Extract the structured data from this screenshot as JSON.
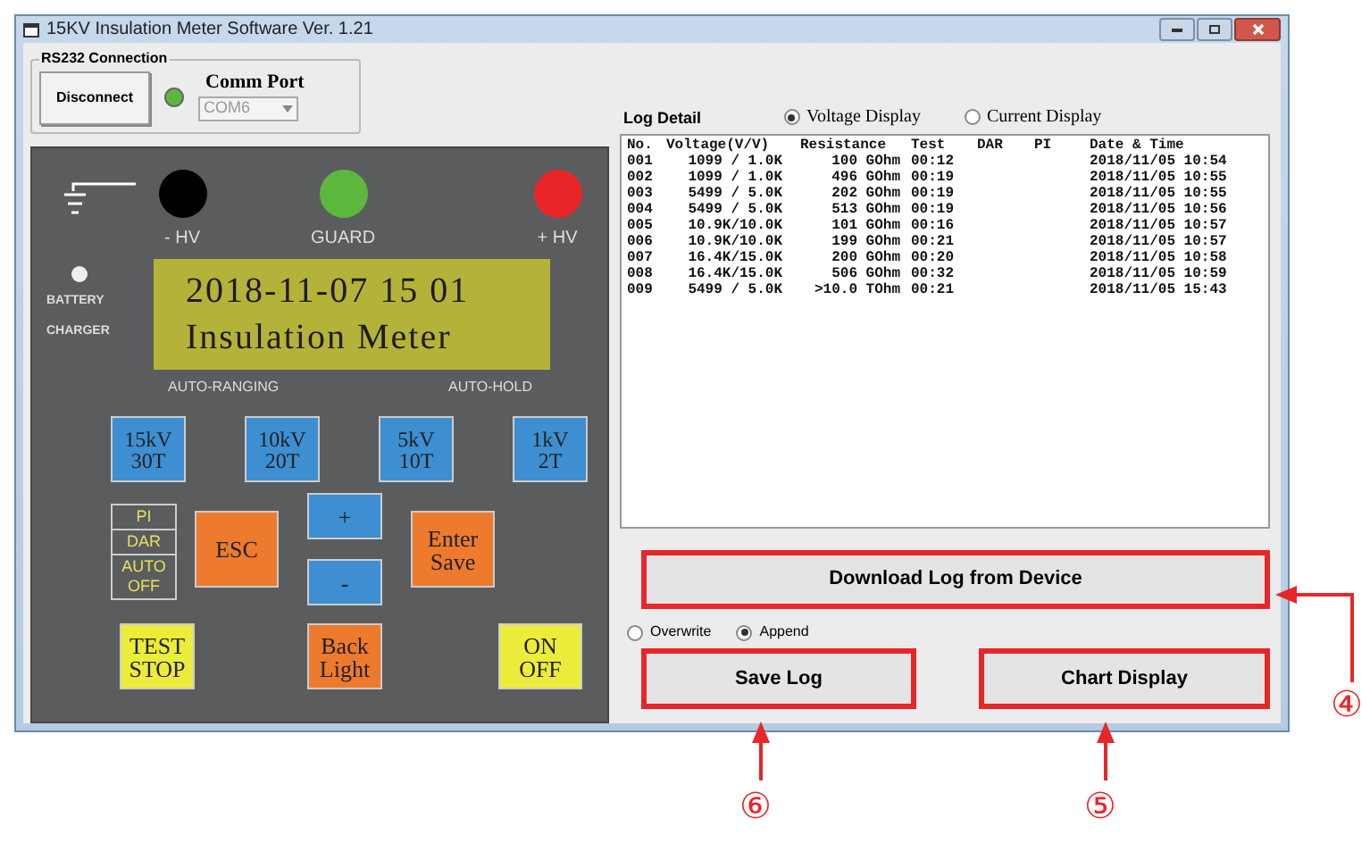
{
  "window": {
    "title": "15KV Insulation Meter Software Ver. 1.21"
  },
  "connection": {
    "group_label": "RS232 Connection",
    "button": "Disconnect",
    "connected": true,
    "comm_port_label": "Comm Port",
    "comm_port": "COM6"
  },
  "device": {
    "terminals": [
      {
        "label": "- HV",
        "color": "#000000"
      },
      {
        "label": "GUARD",
        "color": "#5cb83c"
      },
      {
        "label": "+ HV",
        "color": "#e8262a"
      }
    ],
    "battery_labels": [
      "BATTERY",
      "CHARGER"
    ],
    "lcd_lines": [
      "2018-11-07 15 01",
      "Insulation Meter"
    ],
    "auto_ranging": "AUTO-RANGING",
    "auto_hold": "AUTO-HOLD",
    "range_buttons": [
      {
        "lines": [
          "15kV",
          "30T"
        ]
      },
      {
        "lines": [
          "10kV",
          "20T"
        ]
      },
      {
        "lines": [
          "5kV",
          "10T"
        ]
      },
      {
        "lines": [
          "1kV",
          "2T"
        ]
      }
    ],
    "mode_labels": [
      "PI",
      "DAR",
      "AUTO OFF"
    ],
    "keys": [
      {
        "lines": [
          "ESC"
        ],
        "color": "#ee7a2e"
      },
      {
        "lines": [
          "+"
        ],
        "color": "#3d8fd1"
      },
      {
        "lines": [
          "-"
        ],
        "color": "#3d8fd1"
      },
      {
        "lines": [
          "Enter",
          "Save"
        ],
        "color": "#ee7a2e"
      },
      {
        "lines": [
          "TEST",
          "STOP"
        ],
        "color": "#ecec3a"
      },
      {
        "lines": [
          "Back",
          "Light"
        ],
        "color": "#ee7a2e"
      },
      {
        "lines": [
          "ON",
          "OFF"
        ],
        "color": "#ecec3a"
      }
    ]
  },
  "log": {
    "title": "Log Detail",
    "display_options": [
      {
        "label": "Voltage Display",
        "selected": true
      },
      {
        "label": "Current Display",
        "selected": false
      }
    ],
    "columns": [
      "No.",
      "Voltage(V/V)",
      "Resistance",
      "Test",
      "DAR",
      "PI",
      "Date & Time"
    ],
    "rows": [
      {
        "no": "001",
        "voltage": "1099 / 1.0K",
        "resistance": "100 GOhm",
        "test": "00:12",
        "date_time": "2018/11/05 10:54"
      },
      {
        "no": "002",
        "voltage": "1099 / 1.0K",
        "resistance": "496 GOhm",
        "test": "00:19",
        "date_time": "2018/11/05 10:55"
      },
      {
        "no": "003",
        "voltage": "5499 / 5.0K",
        "resistance": "202 GOhm",
        "test": "00:19",
        "date_time": "2018/11/05 10:55"
      },
      {
        "no": "004",
        "voltage": "5499 / 5.0K",
        "resistance": "513 GOhm",
        "test": "00:19",
        "date_time": "2018/11/05 10:56"
      },
      {
        "no": "005",
        "voltage": "10.9K/10.0K",
        "resistance": "101 GOhm",
        "test": "00:16",
        "date_time": "2018/11/05 10:57"
      },
      {
        "no": "006",
        "voltage": "10.9K/10.0K",
        "resistance": "199 GOhm",
        "test": "00:21",
        "date_time": "2018/11/05 10:57"
      },
      {
        "no": "007",
        "voltage": "16.4K/15.0K",
        "resistance": "200 GOhm",
        "test": "00:20",
        "date_time": "2018/11/05 10:58"
      },
      {
        "no": "008",
        "voltage": "16.4K/15.0K",
        "resistance": "506 GOhm",
        "test": "00:32",
        "date_time": "2018/11/05 10:59"
      },
      {
        "no": "009",
        "voltage": "5499 / 5.0K",
        "resistance": ">10.0 TOhm",
        "test": "00:21",
        "date_time": "2018/11/05 15:43"
      }
    ],
    "download_button": "Download Log from Device",
    "write_modes": [
      {
        "label": "Overwrite",
        "selected": false
      },
      {
        "label": "Append",
        "selected": true
      }
    ],
    "save_button": "Save Log",
    "chart_button": "Chart Display"
  },
  "callouts": [
    {
      "number": "④"
    },
    {
      "number": "⑤"
    },
    {
      "number": "⑥"
    }
  ]
}
